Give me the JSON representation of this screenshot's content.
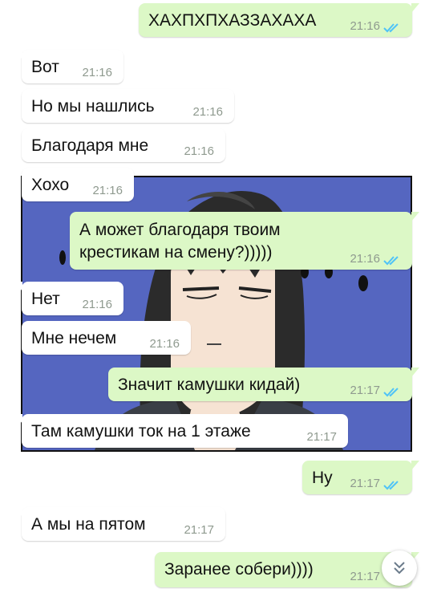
{
  "messages": [
    {
      "text": "ХАХПХПХАЗЗАХАХА",
      "time": "21:16",
      "dir": "out"
    },
    {
      "text": "Вот",
      "time": "21:16",
      "dir": "in"
    },
    {
      "text": "Но мы нашлись",
      "time": "21:16",
      "dir": "in"
    },
    {
      "text": "Благодаря мне",
      "time": "21:16",
      "dir": "in"
    },
    {
      "text": "Хохо",
      "time": "21:16",
      "dir": "in"
    },
    {
      "text_line1": "А может благодаря твоим",
      "text_line2": "крестикам на смену?)))))",
      "time": "21:16",
      "dir": "out"
    },
    {
      "text": "Нет",
      "time": "21:16",
      "dir": "in"
    },
    {
      "text": "Мне нечем",
      "time": "21:16",
      "dir": "in"
    },
    {
      "text": "Значит камушки кидай)",
      "time": "21:17",
      "dir": "out"
    },
    {
      "text": "Там камушки ток на 1 этаже",
      "time": "21:17",
      "dir": "in"
    },
    {
      "text": "Ну",
      "time": "21:17",
      "dir": "out"
    },
    {
      "text": "А мы на пятом",
      "time": "21:17",
      "dir": "in"
    },
    {
      "text": "Заранее собери))))",
      "time": "21:17",
      "dir": "out"
    }
  ],
  "colors": {
    "outgoing_bubble": "#dcf8c6",
    "incoming_bubble": "#ffffff",
    "read_ticks": "#4fc3f7",
    "timestamp": "#8f9a8f",
    "comic_background": "#5566c0"
  },
  "icons": {
    "read_receipt": "double-check-icon",
    "scroll_down": "double-chevron-down-icon"
  }
}
